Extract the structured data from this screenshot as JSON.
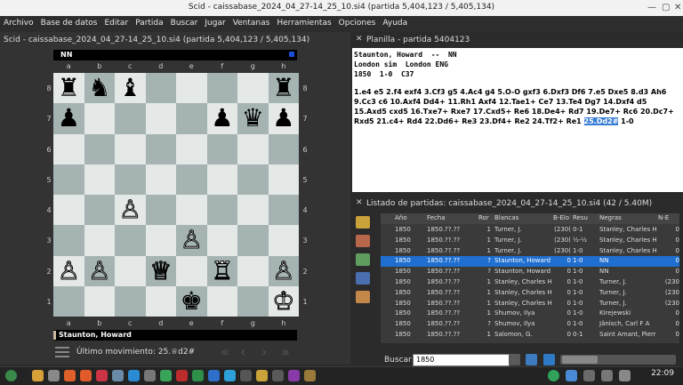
{
  "window": {
    "title": "Scid - caissabase_2024_04_27-14_25_10.si4 (partida 5,404,123 / 5,405,134)"
  },
  "menu": [
    "Archivo",
    "Base de datos",
    "Editar",
    "Partida",
    "Buscar",
    "Jugar",
    "Ventanas",
    "Herramientas",
    "Opciones",
    "Ayuda"
  ],
  "left": {
    "header": "Scid - caissabase_2024_04_27-14_25_10.si4 (partida 5,404,123 / 5,405,134)",
    "top_player": "NN",
    "bottom_player": "Staunton, Howard",
    "last_move_label": "Último movimiento: 25.",
    "last_move_value": "♕d2#",
    "files": [
      "a",
      "b",
      "c",
      "d",
      "e",
      "f",
      "g",
      "h"
    ],
    "ranks": [
      "8",
      "7",
      "6",
      "5",
      "4",
      "3",
      "2",
      "1"
    ],
    "board": [
      [
        "bR",
        "",
        "bB",
        "",
        "",
        "",
        "",
        "bR"
      ],
      [
        "bP",
        "",
        "",
        "",
        "",
        "bP",
        "bQ",
        "bP"
      ],
      [
        "",
        "",
        "",
        "",
        "",
        "",
        "",
        ""
      ],
      [
        "",
        "",
        "",
        "",
        "",
        "",
        "",
        ""
      ],
      [
        "",
        "",
        "wP",
        "",
        "",
        "",
        "",
        ""
      ],
      [
        "",
        "",
        "",
        "",
        "wP",
        "",
        "",
        ""
      ],
      [
        "wP",
        "wP",
        "",
        "wQ",
        "",
        "wR",
        "",
        "wP"
      ],
      [
        "",
        "",
        "",
        "",
        "bK",
        "",
        "",
        "wK"
      ]
    ],
    "board_extra": {
      "knight_on": "b8"
    }
  },
  "notepad": {
    "title": "Planilla - partida 5404123",
    "line1": "Staunton, Howard  --  NN",
    "line2": "London sim  London ENG",
    "line3": "1850  1-0  C37",
    "moves": "1.e4 e5 2.f4 exf4 3.Cf3 g5 4.Ac4 g4 5.O-O gxf3 6.Dxf3 Df6 7.e5 Dxe5 8.d3 Ah6 9.Cc3 c6 10.Axf4 Dd4+ 11.Rh1 Axf4 12.Tae1+ Ce7 13.Te4 Dg7 14.Dxf4 d5 15.Axd5 cxd5 16.Txe7+ Rxe7 17.Cxd5+ Re6 18.De4+ Rd7 19.De7+ Rc6 20.Dc7+ Rxd5 21.c4+ Rd4 22.Dd6+ Re3 23.Df4+ Re2 24.Tf2+ Re1",
    "current_move": "25.Dd2#",
    "result": "1-0"
  },
  "gamelist": {
    "title": "Listado de partidas: caissabase_2024_04_27-14_25_10.si4 (42 / 5.40M)",
    "columns": [
      "Año",
      "Fecha",
      "Ror",
      "Blancas",
      "B-Elo",
      "Resu",
      "Negras",
      "N-E"
    ],
    "rows": [
      [
        "1850",
        "1850.??.??",
        "1",
        "Turner, J.",
        "(230(",
        "0-1",
        "Stanley, Charles H",
        "0"
      ],
      [
        "1850",
        "1850.??.??",
        "1",
        "Turner, J.",
        "(230(",
        "½-½",
        "Stanley, Charles H",
        "0"
      ],
      [
        "1850",
        "1850.??.??",
        "1",
        "Turner, J.",
        "(230(",
        "1-0",
        "Stanley, Charles H",
        "0"
      ],
      [
        "1850",
        "1850.??.??",
        "?",
        "Staunton, Howard",
        "0",
        "1-0",
        "NN",
        "0"
      ],
      [
        "1850",
        "1850.??.??",
        "?",
        "Staunton, Howard",
        "0",
        "1-0",
        "NN",
        "0"
      ],
      [
        "1850",
        "1850.??.??",
        "1",
        "Stanley, Charles H",
        "0",
        "1-0",
        "Turner, J.",
        "(230"
      ],
      [
        "1850",
        "1850.??.??",
        "1",
        "Stanley, Charles H",
        "0",
        "1-0",
        "Turner, J.",
        "(230"
      ],
      [
        "1850",
        "1850.??.??",
        "1",
        "Stanley, Charles H",
        "0",
        "1-0",
        "Turner, J.",
        "(230"
      ],
      [
        "1850",
        "1850.??.??",
        "1",
        "Shumov, Ilya",
        "0",
        "1-0",
        "Kirejewski",
        "0"
      ],
      [
        "1850",
        "1850.??.??",
        "?",
        "Shumov, Ilya",
        "0",
        "1-0",
        "Jänisch, Carl F A",
        "0"
      ],
      [
        "1850",
        "1850.??.??",
        "1",
        "Salomon, G.",
        "0",
        "0-1",
        "Saint Amant, Pierr",
        "0"
      ]
    ],
    "selected_row": 3
  },
  "search": {
    "label": "Buscar",
    "value": "1850"
  },
  "taskbar": {
    "clock": "22:09"
  }
}
